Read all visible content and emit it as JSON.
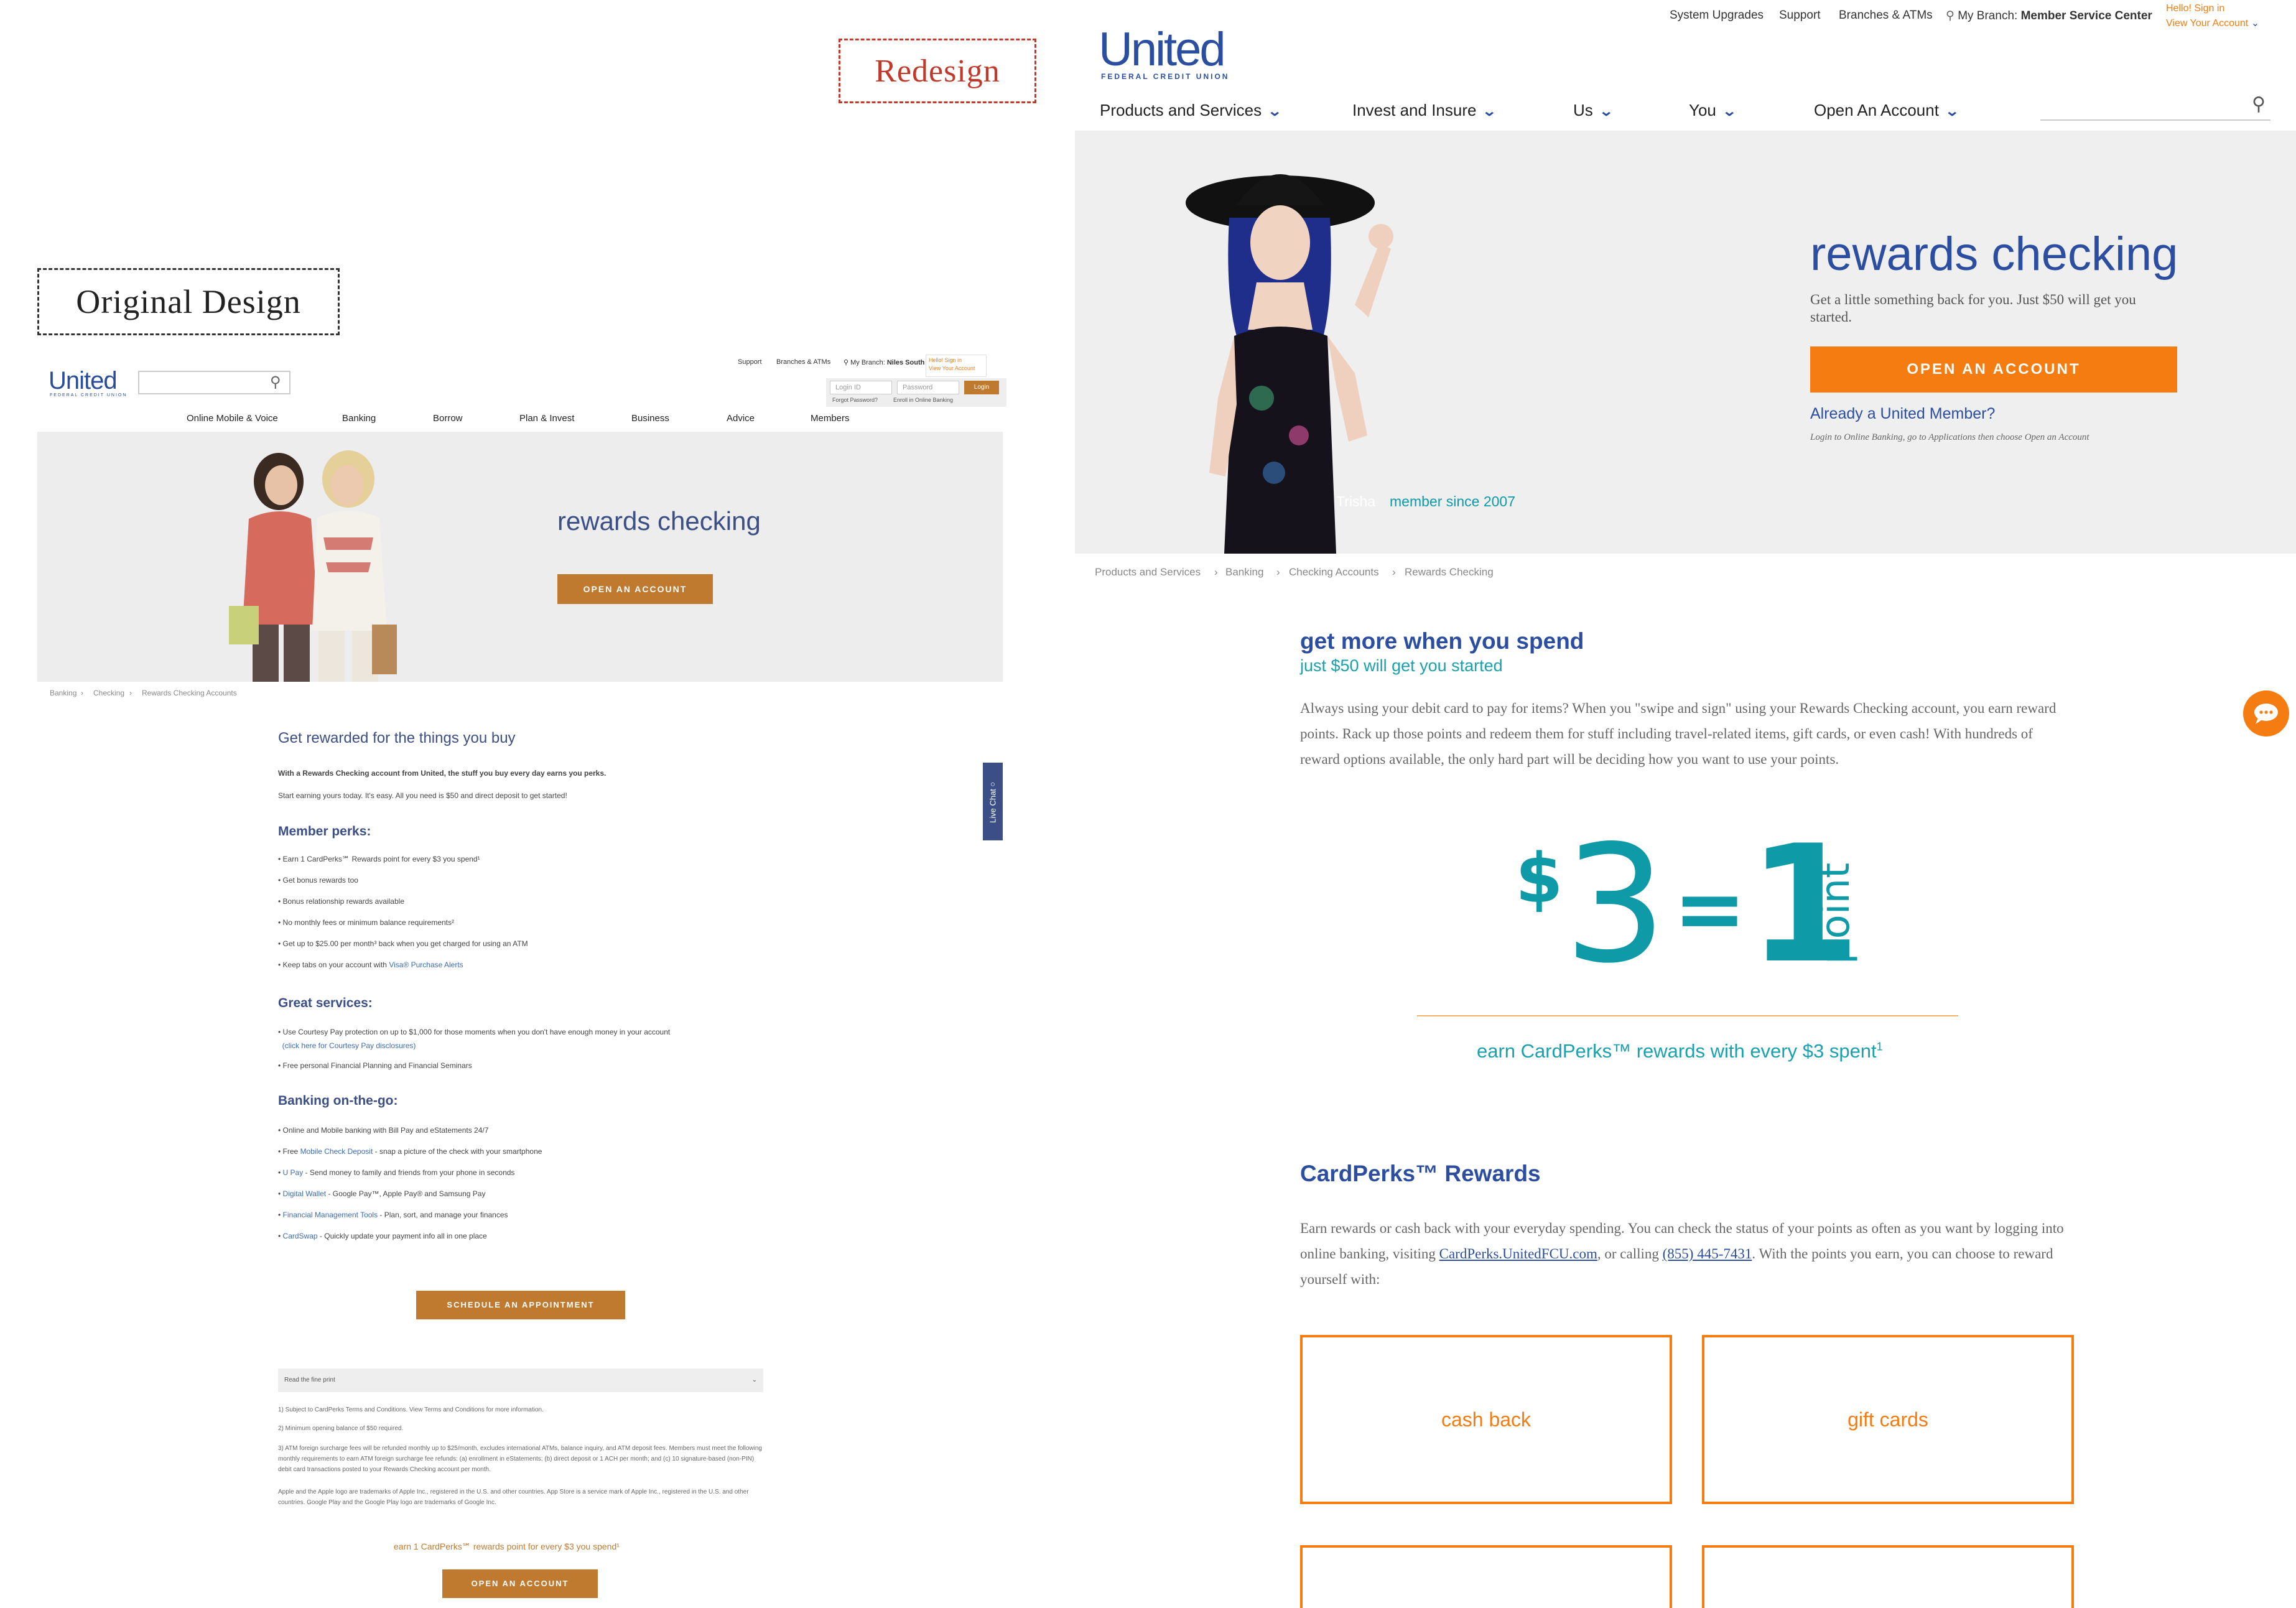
{
  "labels": {
    "redesign": "Redesign",
    "original": "Original Design"
  },
  "original": {
    "logo": "United",
    "logo_sub": "FEDERAL CREDIT UNION",
    "util": {
      "support": "Support",
      "branches": "Branches & ATMs",
      "branch_prefix": "My Branch:",
      "branch": "Niles South"
    },
    "signin": {
      "line1": "Hello! Sign in",
      "line2": "View Your Account"
    },
    "login": {
      "id_placeholder": "Login ID",
      "pw_placeholder": "Password",
      "button": "Login",
      "forgot": "Forgot Password?",
      "enroll": "Enroll in Online Banking"
    },
    "nav": [
      "Online Mobile & Voice",
      "Banking",
      "Borrow",
      "Plan & Invest",
      "Business",
      "Advice",
      "Members"
    ],
    "hero": {
      "title": "rewards checking",
      "button": "OPEN AN ACCOUNT"
    },
    "breadcrumb": [
      "Banking",
      "Checking",
      "Rewards Checking Accounts"
    ],
    "heading": "Get rewarded for the things you buy",
    "intro_bold": "With a Rewards Checking account from United, the stuff you buy every day earns you perks.",
    "intro": "Start earning yours today. It's easy. All you need is $50 and direct deposit to get started!",
    "perks_title": "Member perks:",
    "perks": [
      "Earn 1 CardPerks℠ Rewards point for every $3 you spend¹",
      "Get bonus rewards too",
      "Bonus relationship rewards available",
      "No monthly fees or minimum balance requirements²",
      "Get up to $25.00 per month³ back when you get charged for using an ATM",
      "Keep tabs on your account with "
    ],
    "perks_link": "Visa® Purchase Alerts",
    "services_title": "Great services:",
    "services": {
      "courtesy": "Use Courtesy Pay protection on up to $1,000 for those moments when you don't have enough money in your account",
      "courtesy_link": "(click here for Courtesy Pay disclosures)",
      "planning": "Free personal Financial Planning and Financial Seminars"
    },
    "onthego_title": "Banking on-the-go:",
    "onthego": [
      {
        "prefix": "",
        "link": "",
        "text": "Online and Mobile banking with Bill Pay and eStatements 24/7"
      },
      {
        "prefix": "Free ",
        "link": "Mobile Check Deposit",
        "text": " - snap a picture of the check with your smartphone"
      },
      {
        "prefix": "",
        "link": "U Pay",
        "text": " - Send money to family and friends from your phone in seconds"
      },
      {
        "prefix": "",
        "link": "Digital Wallet",
        "text": " - Google Pay™, Apple Pay® and Samsung Pay"
      },
      {
        "prefix": "",
        "link": "Financial Management Tools",
        "text": " - Plan, sort, and manage your finances"
      },
      {
        "prefix": "",
        "link": "CardSwap",
        "text": " - Quickly update your payment info all in one place"
      }
    ],
    "live_chat": "Live Chat",
    "schedule_button": "SCHEDULE AN APPOINTMENT",
    "fine_print": "Read the fine print",
    "footnotes": [
      "1) Subject to CardPerks Terms and Conditions. View Terms and Conditions for more information.",
      "2) Minimum opening balance of $50 required.",
      "3) ATM foreign surcharge fees will be refunded monthly up to $25/month, excludes international ATMs, balance inquiry, and ATM deposit fees. Members must meet the following monthly requirements to earn ATM foreign surcharge fee refunds: (a) enrollment in eStatements; (b) direct deposit or 1 ACH per month; and (c) 10 signature-based (non-PIN) debit card transactions posted to your Rewards Checking account per month.",
      "Apple and the Apple logo are trademarks of Apple Inc., registered in the U.S. and other countries. App Store is a service mark of Apple Inc., registered in the U.S. and other countries. Google Play and the Google Play logo are trademarks of Google Inc."
    ],
    "earn_line": "earn 1 CardPerks℠ rewards point for every $3 you spend¹",
    "open_button": "OPEN AN ACCOUNT"
  },
  "redesign": {
    "util": {
      "upgrades": "System Upgrades",
      "support": "Support",
      "branches": "Branches & ATMs",
      "branch_prefix": "My Branch:",
      "branch": "Member Service Center",
      "signin1": "Hello! Sign in",
      "signin2": "View Your Account"
    },
    "logo": "United",
    "logo_sub": "FEDERAL CREDIT UNION",
    "nav": [
      "Products and Services",
      "Invest and Insure",
      "Us",
      "You",
      "Open An Account"
    ],
    "hero": {
      "title": "rewards checking",
      "subtitle": "Get a little something back for you. Just $50 will get you started.",
      "button": "OPEN AN ACCOUNT",
      "already": "Already a United Member?",
      "already_sub": "Login to Online Banking, go to Applications then choose Open an Account",
      "name": "Trisha",
      "since": "member since 2007"
    },
    "breadcrumb": [
      "Products and Services",
      "Banking",
      "Checking Accounts",
      "Rewards Checking"
    ],
    "spend_title": "get more when you spend",
    "spend_sub": "just $50 will get you started",
    "spend_body": "Always using your debit card to pay for items? When you \"swipe and sign\" using your Rewards Checking account, you earn reward points. Rack up those points and redeem them for stuff including travel-related items, gift cards, or even cash! With hundreds of reward options available, the only hard part will be deciding how you want to use your points.",
    "equation": {
      "dollar": "$",
      "three": "3",
      "equals": "=",
      "one": "1",
      "point": "point"
    },
    "earn": "earn CardPerks™ rewards with every $3 spent",
    "earn_sup": "1",
    "cardperks_title": "CardPerks™ Rewards",
    "cardperks_body1": "Earn rewards or cash back with your everyday spending. You can check the status of your points as often as you want by logging into online banking, visiting ",
    "cardperks_link": "CardPerks.UnitedFCU.com",
    "cardperks_body2": ", or calling ",
    "cardperks_phone": "(855) 445-7431",
    "cardperks_body3": ". With the points you earn, you can choose to reward yourself with:",
    "boxes": [
      "cash back",
      "gift cards"
    ]
  },
  "colors": {
    "orange": "#f57c10",
    "brown": "#c07a30",
    "blue": "#2b4ea0",
    "teal": "#1aa1ae",
    "red_label": "#c0392b"
  }
}
